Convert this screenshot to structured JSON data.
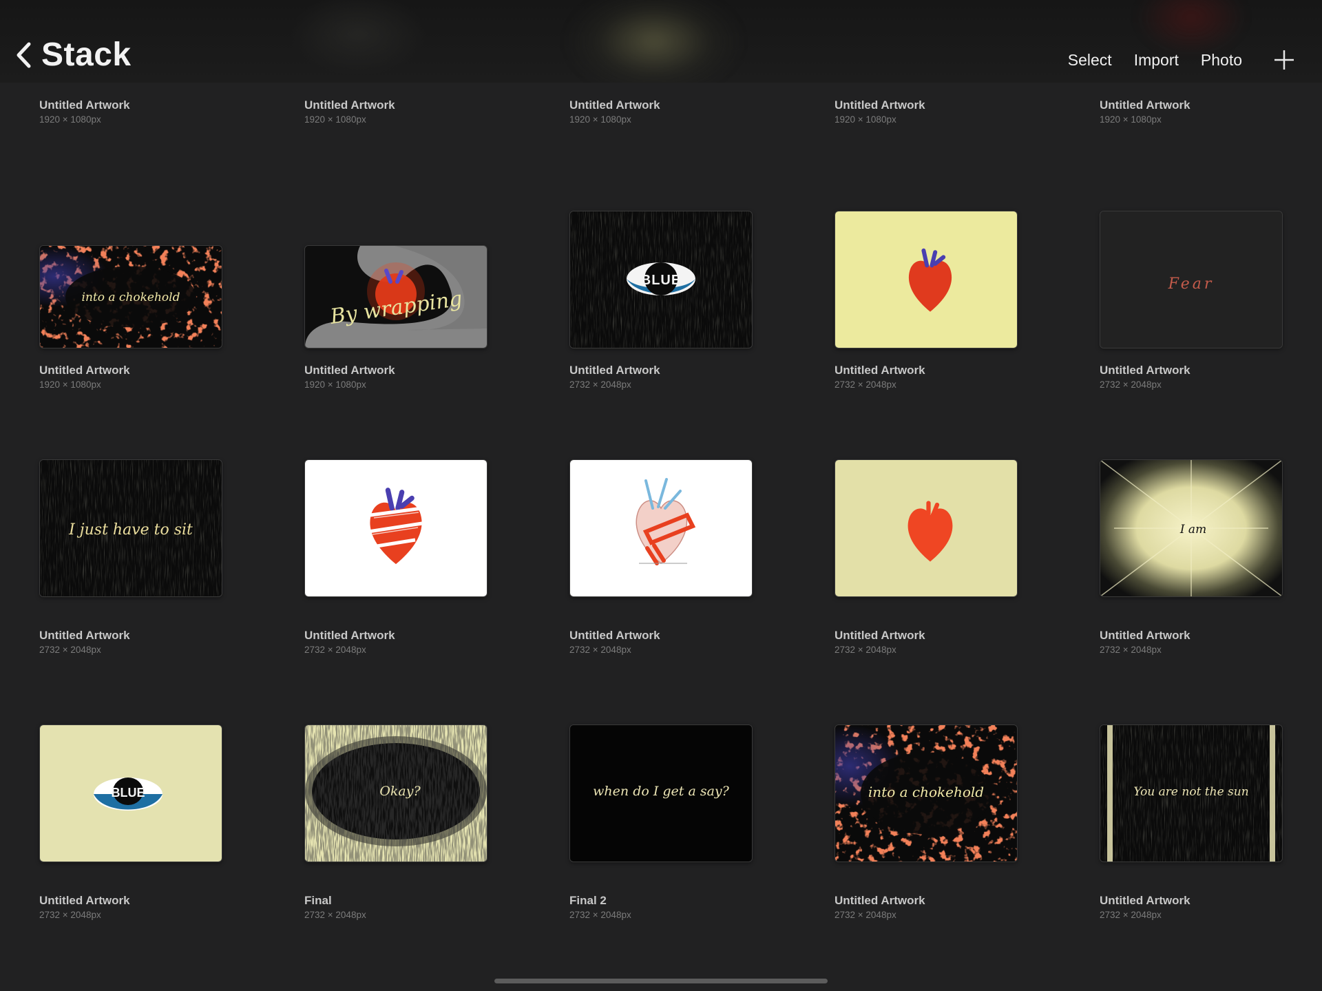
{
  "header": {
    "back_label": "Stack",
    "actions": [
      "Select",
      "Import",
      "Photo"
    ],
    "add_icon": "plus-icon"
  },
  "rows": [
    {
      "top_row_partial": true,
      "items": [
        {
          "name": "Untitled Artwork",
          "size": "1920 × 1080px",
          "art": "none"
        },
        {
          "name": "Untitled Artwork",
          "size": "1920 × 1080px",
          "art": "none"
        },
        {
          "name": "Untitled Artwork",
          "size": "1920 × 1080px",
          "art": "none"
        },
        {
          "name": "Untitled Artwork",
          "size": "1920 × 1080px",
          "art": "none"
        },
        {
          "name": "Untitled Artwork",
          "size": "1920 × 1080px",
          "art": "none"
        }
      ]
    },
    {
      "items": [
        {
          "name": "Untitled Artwork",
          "size": "1920 × 1080px",
          "art": "chokehold-wide",
          "caption": "into a chokehold"
        },
        {
          "name": "Untitled Artwork",
          "size": "1920 × 1080px",
          "art": "wrapping",
          "caption": "By wrapping"
        },
        {
          "name": "Untitled Artwork",
          "size": "2732 × 2048px",
          "art": "eye-dark",
          "caption": "BLUE"
        },
        {
          "name": "Untitled Artwork",
          "size": "2732 × 2048px",
          "art": "heart-yellow-vein"
        },
        {
          "name": "Untitled Artwork",
          "size": "2732 × 2048px",
          "art": "fear",
          "caption": "Fear"
        }
      ]
    },
    {
      "items": [
        {
          "name": "Untitled Artwork",
          "size": "2732 × 2048px",
          "art": "sit",
          "caption": "I just have to sit"
        },
        {
          "name": "Untitled Artwork",
          "size": "2732 × 2048px",
          "art": "heart-wrapped-white"
        },
        {
          "name": "Untitled Artwork",
          "size": "2732 × 2048px",
          "art": "heart-sketch-white"
        },
        {
          "name": "Untitled Artwork",
          "size": "2732 × 2048px",
          "art": "heart-yellow"
        },
        {
          "name": "Untitled Artwork",
          "size": "2732 × 2048px",
          "art": "sun-burst",
          "caption": "I am"
        }
      ]
    },
    {
      "items": [
        {
          "name": "Untitled Artwork",
          "size": "2732 × 2048px",
          "art": "eye-yellow",
          "caption": "BLUE"
        },
        {
          "name": "Final",
          "size": "2732 × 2048px",
          "art": "okay",
          "caption": "Okay?"
        },
        {
          "name": "Final 2",
          "size": "2732 × 2048px",
          "art": "say",
          "caption": "when do I get a say?"
        },
        {
          "name": "Untitled Artwork",
          "size": "2732 × 2048px",
          "art": "chokehold",
          "caption": "into a chokehold"
        },
        {
          "name": "Untitled Artwork",
          "size": "2732 × 2048px",
          "art": "not-sun",
          "caption": "You are not the sun"
        }
      ]
    }
  ],
  "colors": {
    "background": "#212122",
    "accent_red": "#e8401f",
    "cream": "#e5e3b2",
    "blue": "#1e6fa3"
  }
}
